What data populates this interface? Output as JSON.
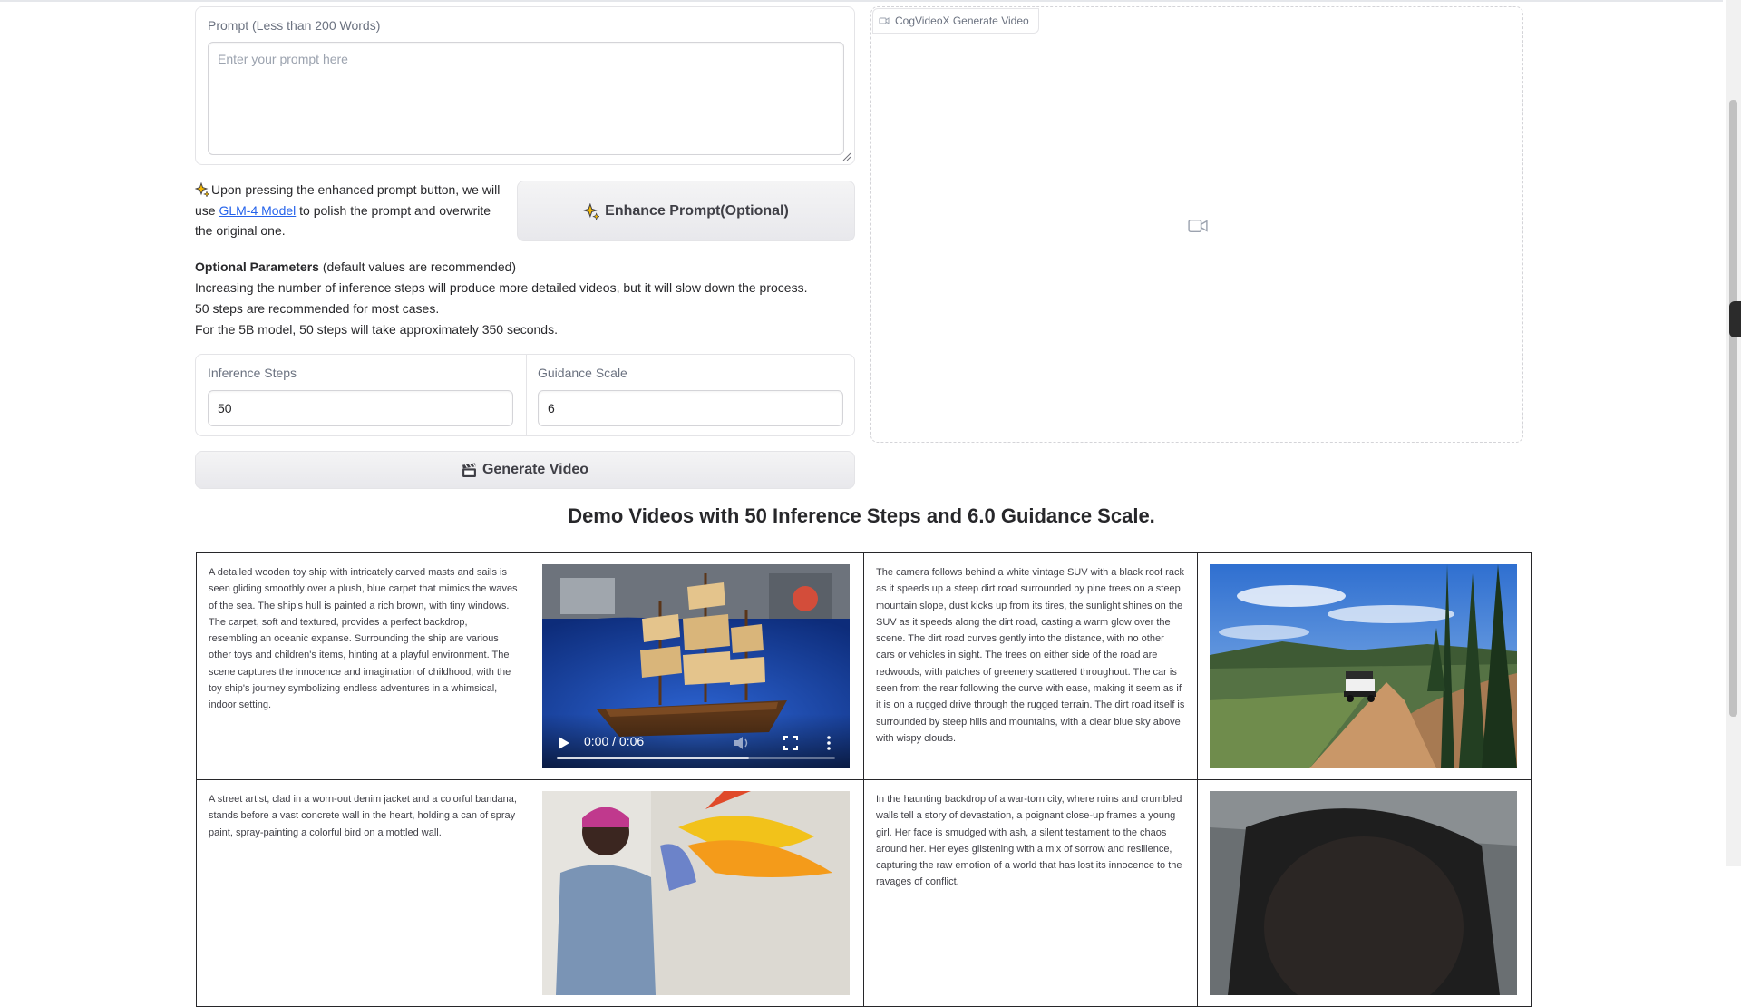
{
  "prompt": {
    "label": "Prompt (Less than 200 Words)",
    "placeholder": "Enter your prompt here",
    "value": ""
  },
  "enhance": {
    "text_before": "Upon pressing the enhanced prompt button, we will use ",
    "link_label": "GLM-4 Model",
    "text_after": " to polish the prompt and overwrite the original one.",
    "button_label": "Enhance Prompt(Optional)"
  },
  "optional_params": {
    "heading_bold": "Optional Parameters",
    "heading_rest": " (default values are recommended)",
    "lines": [
      "Increasing the number of inference steps will produce more detailed videos, but it will slow down the process.",
      "50 steps are recommended for most cases.",
      "For the 5B model, 50 steps will take approximately 350 seconds."
    ]
  },
  "inference_steps": {
    "label": "Inference Steps",
    "value": "50"
  },
  "guidance_scale": {
    "label": "Guidance Scale",
    "value": "6"
  },
  "generate_button_label": "Generate Video",
  "video_output": {
    "label": "CogVideoX Generate Video"
  },
  "demo": {
    "title": "Demo Videos with 50 Inference Steps and 6.0 Guidance Scale.",
    "items": [
      {
        "description": "A detailed wooden toy ship with intricately carved masts and sails is seen gliding smoothly over a plush, blue carpet that mimics the waves of the sea. The ship's hull is painted a rich brown, with tiny windows. The carpet, soft and textured, provides a perfect backdrop, resembling an oceanic expanse. Surrounding the ship are various other toys and children's items, hinting at a playful environment. The scene captures the innocence and imagination of childhood, with the toy ship's journey symbolizing endless adventures in a whimsical, indoor setting.",
        "time": "0:00 / 0:06",
        "buffered": 0.69
      },
      {
        "description": "The camera follows behind a white vintage SUV with a black roof rack as it speeds up a steep dirt road surrounded by pine trees on a steep mountain slope, dust kicks up from its tires, the sunlight shines on the SUV as it speeds along the dirt road, casting a warm glow over the scene. The dirt road curves gently into the distance, with no other cars or vehicles in sight. The trees on either side of the road are redwoods, with patches of greenery scattered throughout. The car is seen from the rear following the curve with ease, making it seem as if it is on a rugged drive through the rugged terrain. The dirt road itself is surrounded by steep hills and mountains, with a clear blue sky above with wispy clouds."
      },
      {
        "description": "A street artist, clad in a worn-out denim jacket and a colorful bandana, stands before a vast concrete wall in the heart, holding a can of spray paint, spray-painting a colorful bird on a mottled wall."
      },
      {
        "description": "In the haunting backdrop of a war-torn city, where ruins and crumbled walls tell a story of devastation, a poignant close-up frames a young girl. Her face is smudged with ash, a silent testament to the chaos around her. Her eyes glistening with a mix of sorrow and resilience, capturing the raw emotion of a world that has lost its innocence to the ravages of conflict."
      }
    ]
  }
}
